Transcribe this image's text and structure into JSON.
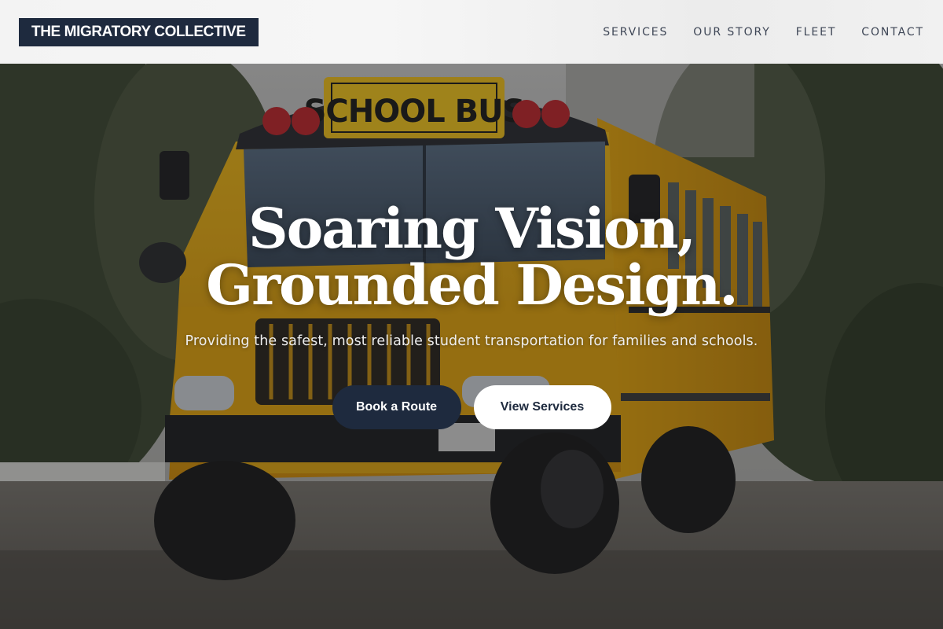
{
  "header": {
    "logo": "THE MIGRATORY COLLECTIVE",
    "nav": [
      {
        "label": "SERVICES"
      },
      {
        "label": "OUR STORY"
      },
      {
        "label": "FLEET"
      },
      {
        "label": "CONTACT"
      }
    ]
  },
  "hero": {
    "title_line1": "Soaring Vision,",
    "title_line2": "Grounded Design.",
    "subtitle": "Providing the safest, most reliable student transportation for families and schools.",
    "bus_sign": "SCHOOL BUS",
    "primary_cta": "Book a Route",
    "secondary_cta": "View Services"
  },
  "colors": {
    "brand_navy": "#1e2a3e",
    "header_bg": "#f3f3f3",
    "bus_yellow": "#e0a411",
    "white": "#ffffff"
  }
}
